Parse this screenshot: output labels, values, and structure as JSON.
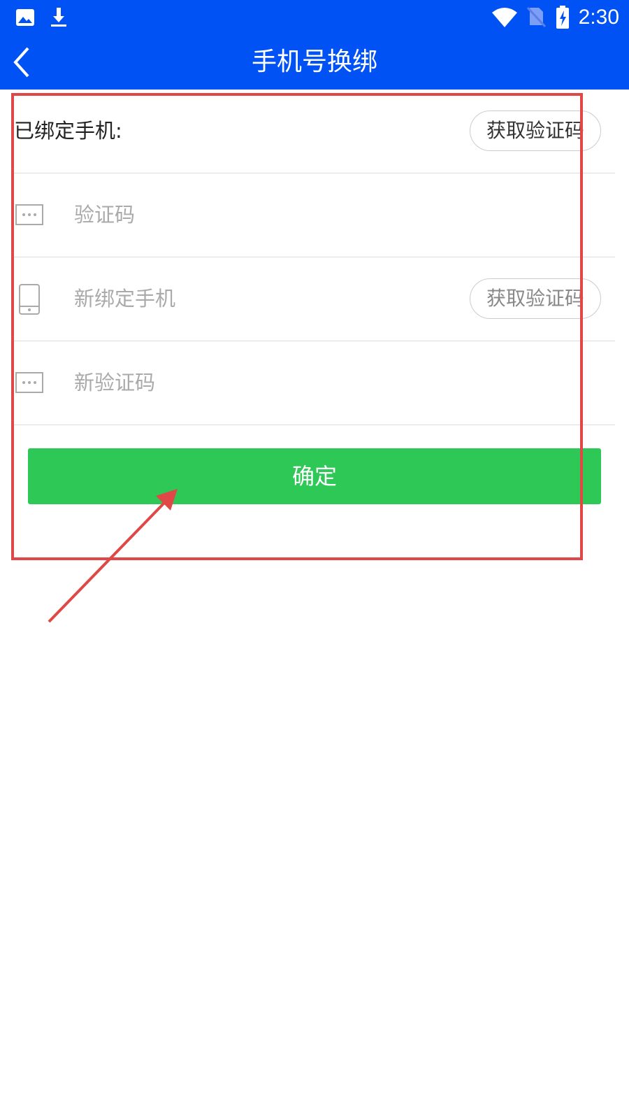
{
  "status_bar": {
    "time": "2:30",
    "left_icons": [
      "image-icon",
      "download-icon"
    ],
    "right_icons": [
      "wifi-icon",
      "no-sim-icon",
      "battery-charging-icon"
    ]
  },
  "app_bar": {
    "title": "手机号换绑",
    "back_icon": "chevron-left-icon"
  },
  "form": {
    "bound_phone_label": "已绑定手机:",
    "get_code_label": "获取验证码",
    "code_placeholder": "验证码",
    "new_phone_placeholder": "新绑定手机",
    "new_get_code_label": "获取验证码",
    "new_code_placeholder": "新验证码",
    "confirm_label": "确定"
  },
  "colors": {
    "primary": "#0052f5",
    "confirm": "#2dc856",
    "annotation": "#e04848"
  }
}
